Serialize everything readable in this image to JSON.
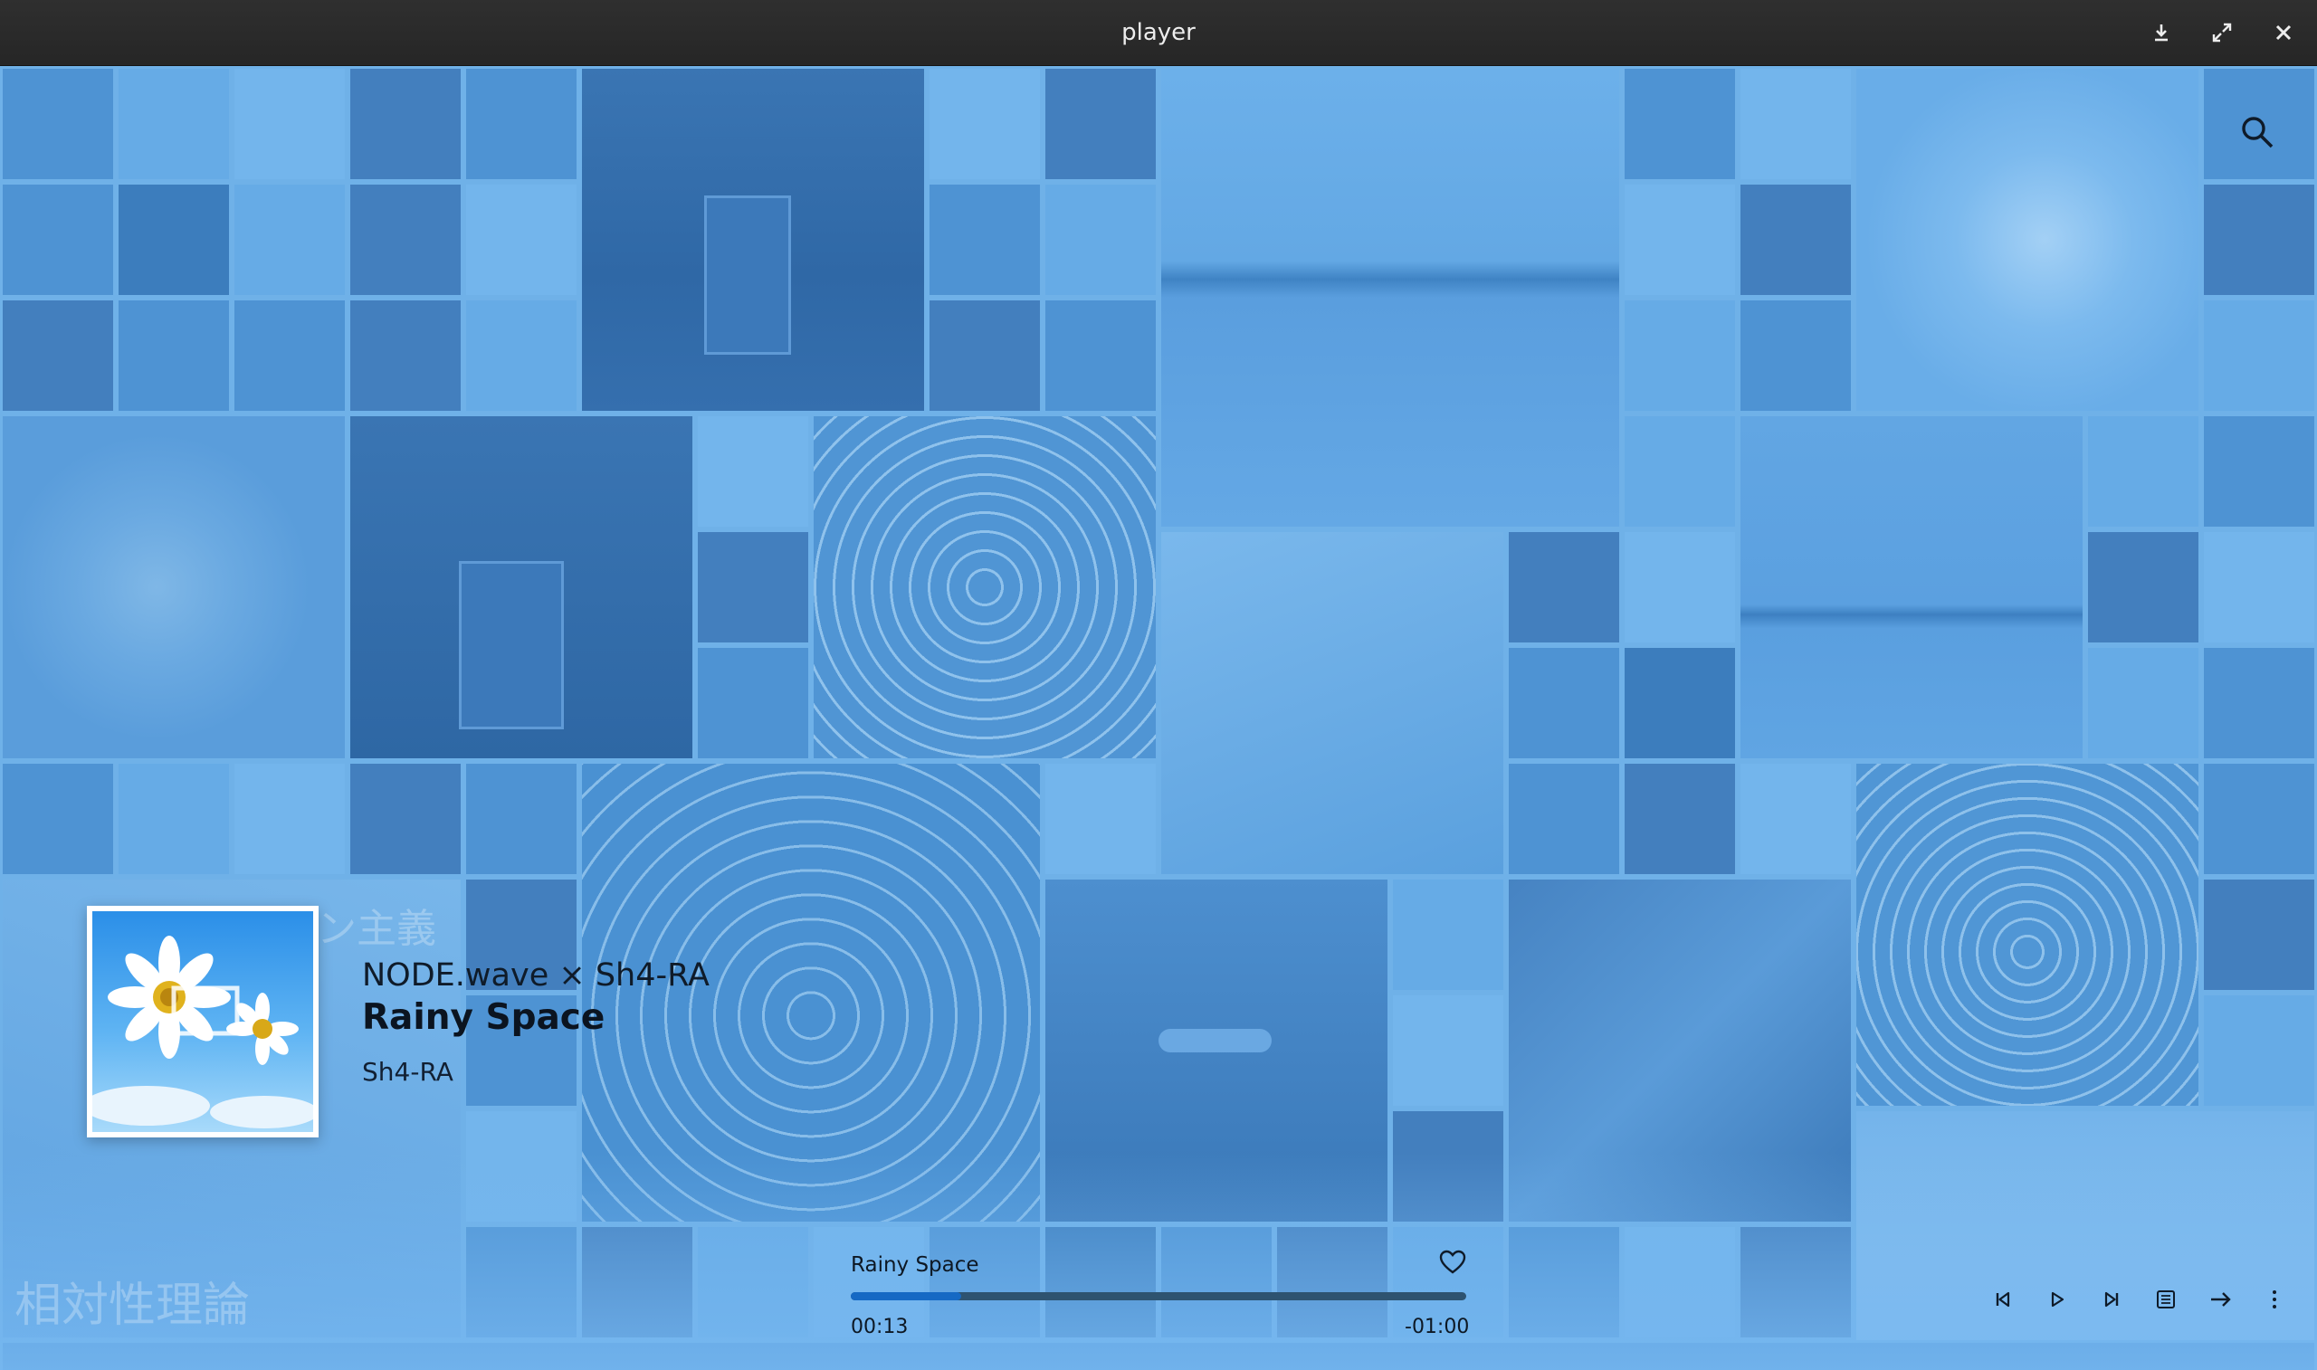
{
  "window": {
    "title": "player",
    "buttons": [
      {
        "name": "download-icon"
      },
      {
        "name": "fullscreen-icon"
      },
      {
        "name": "close-icon"
      }
    ]
  },
  "background_text": {
    "jp_top": "ン主義",
    "jp_bottom": "相対性理論"
  },
  "now_playing": {
    "artist": "NODE.wave × Sh4-RA",
    "title": "Rainy Space",
    "album": "Sh4-RA"
  },
  "player_bar": {
    "track": "Rainy Space",
    "elapsed": "00:13",
    "remaining": "-01:00",
    "progress": 0.18,
    "controls": [
      {
        "name": "previous-track-icon"
      },
      {
        "name": "play-icon"
      },
      {
        "name": "next-track-icon"
      },
      {
        "name": "playlist-icon"
      },
      {
        "name": "repeat-arrow-icon"
      },
      {
        "name": "more-menu-icon"
      }
    ]
  },
  "colors": {
    "tint": "#4a95d8",
    "titlebar": "#2b2b2b",
    "progress_fill": "#1669c4",
    "progress_track": "#2e5370"
  }
}
